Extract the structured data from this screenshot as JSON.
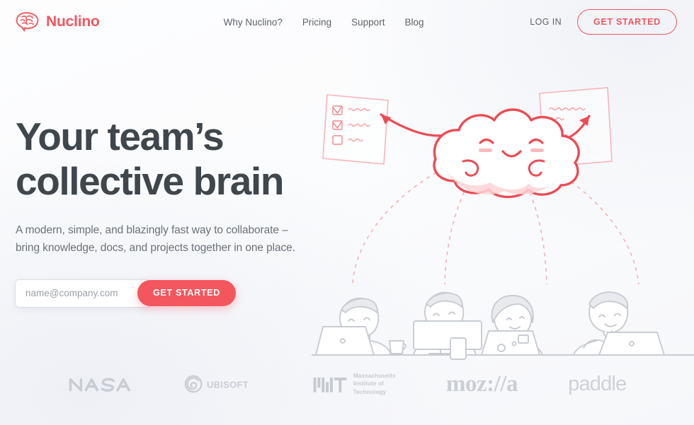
{
  "header": {
    "brand": {
      "name": "Nuclino",
      "logo_icon": "brain-speech-bubble-icon",
      "color": "#F4565E"
    },
    "nav": [
      {
        "label": "Why Nuclino?",
        "name": "nav-why-nuclino"
      },
      {
        "label": "Pricing",
        "name": "nav-pricing"
      },
      {
        "label": "Support",
        "name": "nav-support"
      },
      {
        "label": "Blog",
        "name": "nav-blog"
      }
    ],
    "login_label": "LOG IN",
    "cta_label": "GET STARTED"
  },
  "hero": {
    "headline_line1": "Your team’s",
    "headline_line2": "collective brain",
    "subhead_line1": "A modern, simple, and blazingly fast way to collaborate –",
    "subhead_line2": "bring knowledge, docs, and projects together in one place.",
    "email_placeholder": "name@company.com",
    "email_value": "",
    "cta_label": "GET STARTED"
  },
  "illustration": {
    "cloud_icon": "smiling-cloud-icon",
    "checklist_card_icon": "checklist-card-icon",
    "document_card_icon": "document-card-icon",
    "people_icon": "four-people-at-desk-icon",
    "accent_color": "#F4565E",
    "line_color": "#c8ccd2"
  },
  "clients": [
    {
      "name": "NASA",
      "logo_name": "nasa-logo"
    },
    {
      "name": "UBISOFT",
      "logo_name": "ubisoft-logo"
    },
    {
      "name": "MIT",
      "logo_name": "mit-logo",
      "line1": "Massachusetts",
      "line2": "Institute of",
      "line3": "Technology"
    },
    {
      "name": "moz://a",
      "logo_name": "mozilla-logo"
    },
    {
      "name": "paddle",
      "logo_name": "paddle-logo"
    }
  ]
}
